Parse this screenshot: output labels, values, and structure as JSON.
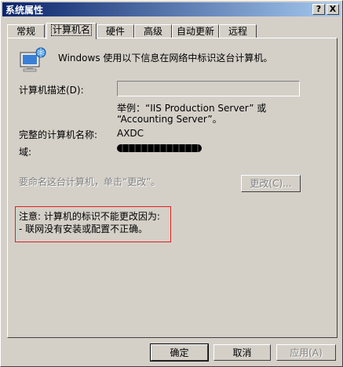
{
  "window": {
    "title": "系统属性"
  },
  "titlebar_buttons": {
    "help": "?",
    "close": "X"
  },
  "tabs": [
    {
      "label": "常规"
    },
    {
      "label": "计算机名"
    },
    {
      "label": "硬件"
    },
    {
      "label": "高级"
    },
    {
      "label": "自动更新"
    },
    {
      "label": "远程"
    }
  ],
  "active_tab": "计算机名",
  "intro": "Windows 使用以下信息在网络中标识这台计算机。",
  "description": {
    "label": "计算机描述(D):",
    "value": "",
    "example_line1": "举例：“IIS Production Server” 或",
    "example_line2": "“Accounting Server”。"
  },
  "full_name": {
    "label": "完整的计算机名称:",
    "value": "AXDC"
  },
  "domain": {
    "label": "域:"
  },
  "rename": {
    "text": "要命名这台计算机，单击“更改”。",
    "button": "更改(C)..."
  },
  "note": {
    "line1": "注意: 计算机的标识不能更改因为:",
    "line2": "- 联网没有安装或配置不正确。"
  },
  "footer": {
    "ok": "确定",
    "cancel": "取消",
    "apply": "应用(A)"
  },
  "colors": {
    "titlebar_start": "#0a246a",
    "titlebar_end": "#a6caf0",
    "face": "#d4d0c8",
    "note_border": "#e02020"
  }
}
